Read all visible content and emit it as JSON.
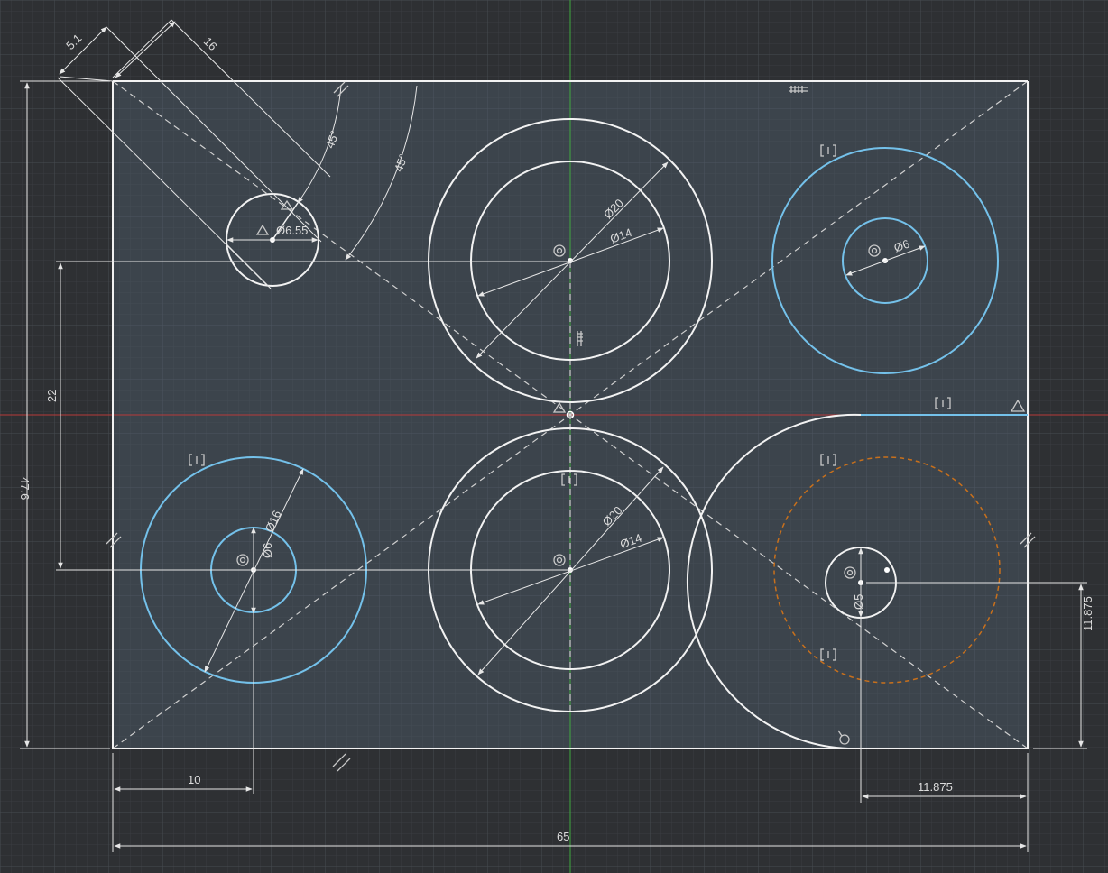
{
  "sketch": {
    "colors": {
      "background": "#2e3033",
      "grid_minor": "#3a3d41",
      "grid_major": "#474b50",
      "sheet_fill": "#3f4a52",
      "line_white": "#f2f2f2",
      "line_blue": "#74c1ea",
      "construction_orange": "#c8701c",
      "axis_red": "#b83a3a",
      "axis_green": "#3fa83f",
      "dimension": "#e6e6e6"
    },
    "dimensions": {
      "d1": "Ø20",
      "d2": "Ø14",
      "d3": "Ø20",
      "d4": "Ø14",
      "d5": "Ø6",
      "d6": "Ø16",
      "d7": "Ø6",
      "d8": "Ø6.55",
      "d9": "Ø5",
      "w_total": "65",
      "w_10": "10",
      "w_11875": "11.875",
      "h_11875": "11.875",
      "h_476": "47.6",
      "h_22": "22",
      "ang1": "45°",
      "ang2": "45°",
      "len_51": "5.1",
      "len_16": "16"
    },
    "icons": {
      "concentric": "concentric-constraint-icon",
      "midpoint": "midpoint-constraint-icon",
      "horizontal": "horizontal-constraint-icon",
      "vertical": "vertical-constraint-icon",
      "parallel": "parallel-constraint-icon",
      "tangent": "tangent-constraint-icon",
      "fix": "fix-constraint-icon",
      "symmetry": "symmetry-constraint-icon"
    }
  }
}
